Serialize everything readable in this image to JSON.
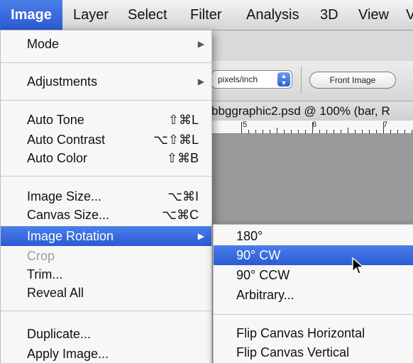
{
  "menubar": {
    "items": [
      {
        "label": "Image"
      },
      {
        "label": "Layer"
      },
      {
        "label": "Select"
      },
      {
        "label": "Filter"
      },
      {
        "label": "Analysis"
      },
      {
        "label": "3D"
      },
      {
        "label": "View"
      },
      {
        "label": "V"
      }
    ]
  },
  "options_bar": {
    "unit_select_value": "pixels/inch",
    "front_image_label": "Front Image"
  },
  "document": {
    "tab_title": "bbggraphic2.psd @ 100% (bar, R",
    "ruler_labels": [
      "5",
      "6",
      "7"
    ]
  },
  "image_menu": {
    "items": [
      {
        "label": "Mode",
        "submenu": true
      },
      {
        "label": "Adjustments",
        "submenu": true
      },
      {
        "label": "Auto Tone",
        "shortcut": "⇧⌘L"
      },
      {
        "label": "Auto Contrast",
        "shortcut": "⌥⇧⌘L"
      },
      {
        "label": "Auto Color",
        "shortcut": "⇧⌘B"
      },
      {
        "label": "Image Size...",
        "shortcut": "⌥⌘I"
      },
      {
        "label": "Canvas Size...",
        "shortcut": "⌥⌘C"
      },
      {
        "label": "Image Rotation",
        "submenu": true,
        "highlighted": true
      },
      {
        "label": "Crop",
        "disabled": true
      },
      {
        "label": "Trim..."
      },
      {
        "label": "Reveal All"
      },
      {
        "label": "Duplicate..."
      },
      {
        "label": "Apply Image..."
      }
    ]
  },
  "rotation_submenu": {
    "items": [
      {
        "label": "180°"
      },
      {
        "label": "90° CW",
        "highlighted": true
      },
      {
        "label": "90° CCW"
      },
      {
        "label": "Arbitrary..."
      },
      {
        "label": "Flip Canvas Horizontal"
      },
      {
        "label": "Flip Canvas Vertical"
      }
    ]
  },
  "icons": {
    "submenu_arrow": "triangle-right-icon",
    "stepper": "up-down-stepper-icon",
    "cursor": "mouse-pointer-icon"
  },
  "colors": {
    "highlight": "#2f62d6",
    "menu_background": "#f7f7f7",
    "disabled_text": "#9c9c9c"
  }
}
